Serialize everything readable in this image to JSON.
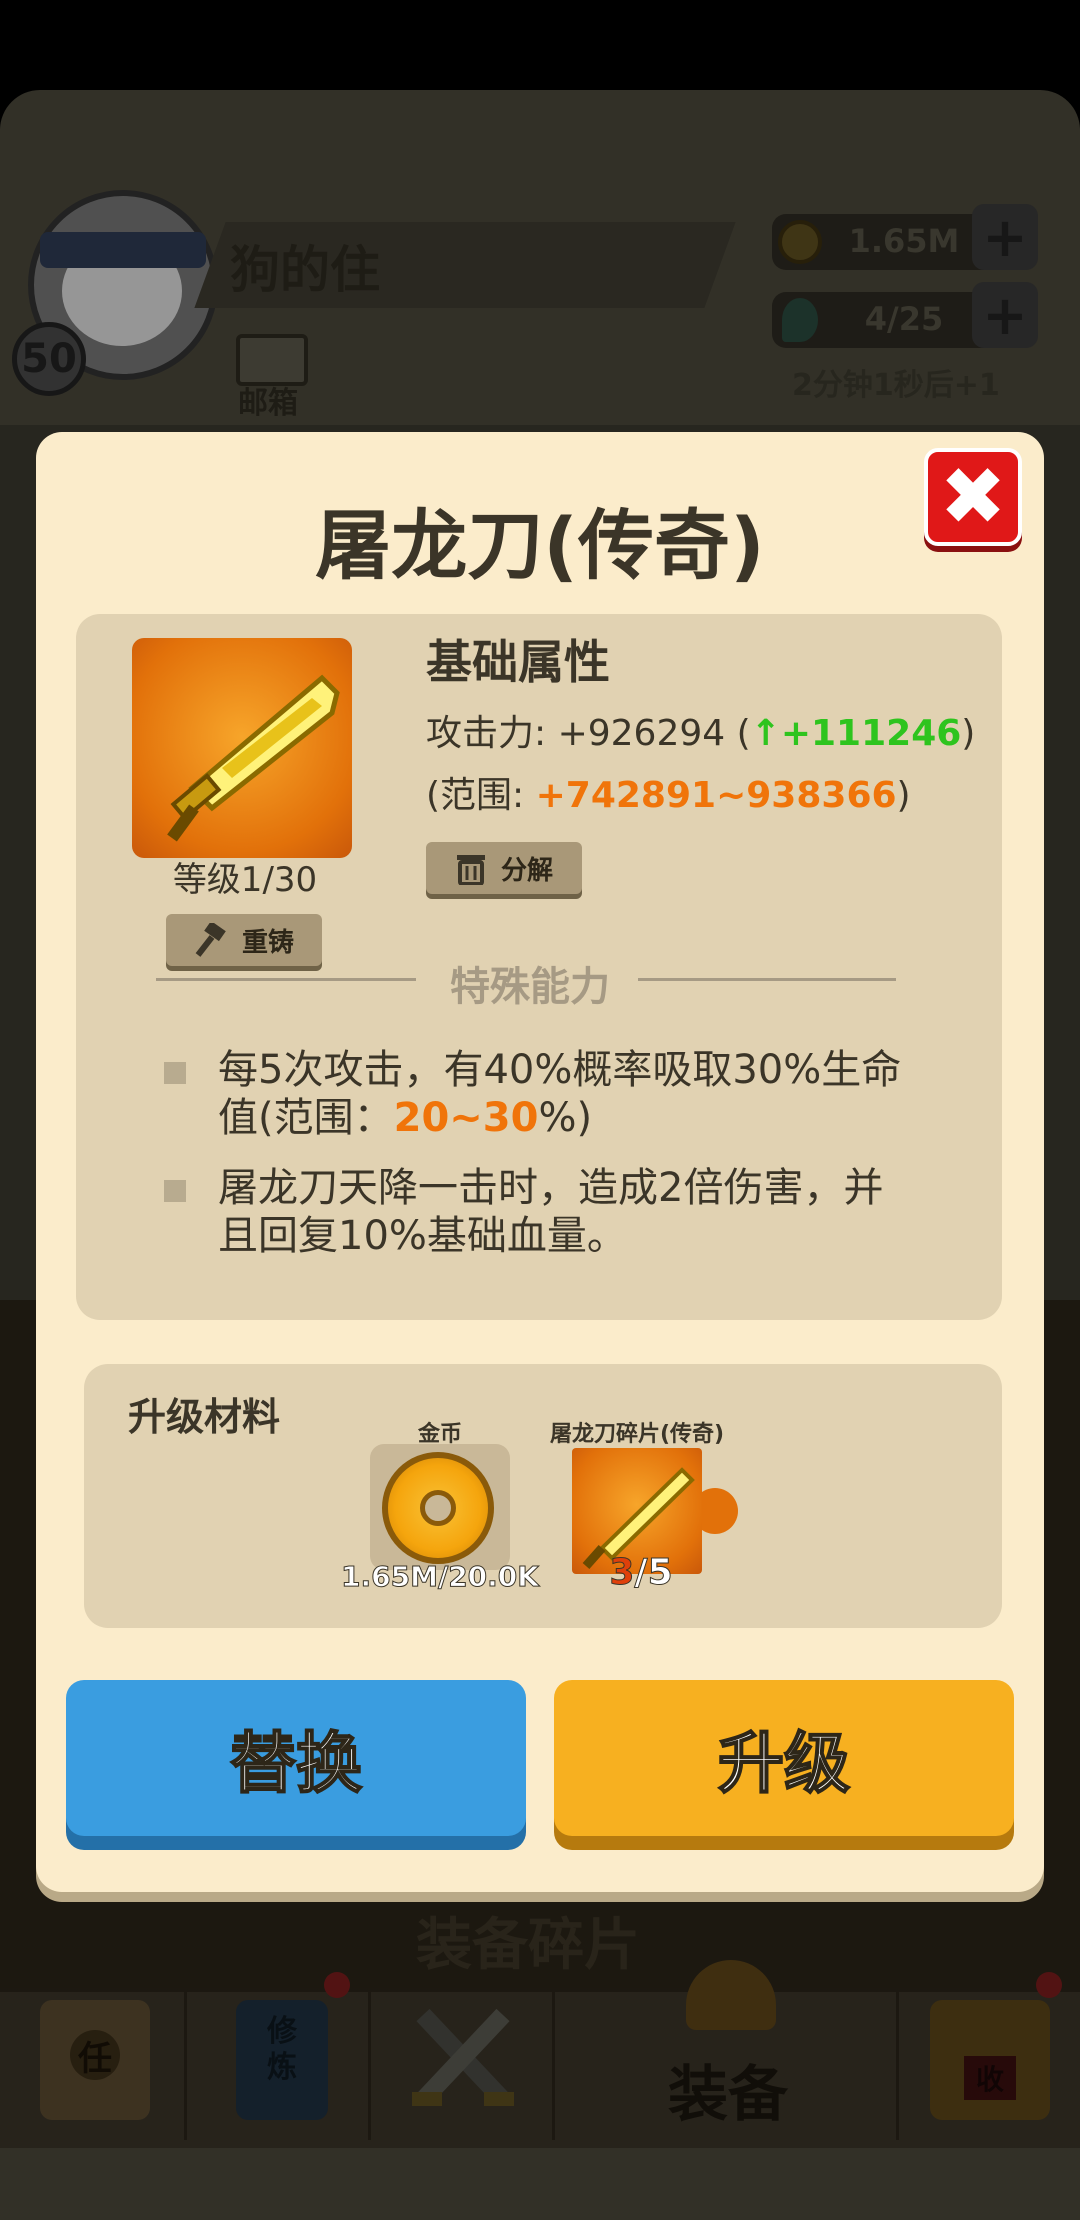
{
  "header": {
    "player_name": "狗的住",
    "level": "50",
    "mail_label": "邮箱",
    "gold_value": "1.65M",
    "energy_value": "4/25",
    "timer_text": "2分钟1秒后+1",
    "plus_symbol": "+"
  },
  "background": {
    "hidden_section_title": "装备碎片"
  },
  "bottom_nav": {
    "items": [
      {
        "icon": "scroll-icon",
        "text": "任"
      },
      {
        "icon": "book-icon",
        "text": "修炼"
      },
      {
        "icon": "crossed-swords-icon",
        "text": ""
      },
      {
        "icon": "helmet-icon",
        "label": "装备"
      },
      {
        "icon": "shop-icon",
        "text": "收"
      }
    ]
  },
  "dialog": {
    "title": "屠龙刀(传奇)",
    "close_symbol": "✖",
    "item": {
      "icon": "golden-sword-icon",
      "level_text": "等级1/30",
      "recast_label": "重铸",
      "decompose_label": "分解"
    },
    "base_attr": {
      "title": "基础属性",
      "attack_prefix": "攻击力: +926294 (",
      "attack_arrow": "↑",
      "attack_increase": "+111246",
      "attack_suffix": ")",
      "range_prefix": "(范围: ",
      "range_value": "+742891~938366",
      "range_suffix": ")"
    },
    "special": {
      "title": "特殊能力",
      "abilities": [
        {
          "pre": "每5次攻击，有40%概率吸取30%生命值(范围：",
          "highlight": "20~30",
          "post": "%)"
        },
        {
          "pre": "屠龙刀天降一击时，造成2倍伤害，并且回复10%基础血量。",
          "highlight": "",
          "post": ""
        }
      ]
    },
    "materials": {
      "title": "升级材料",
      "items": [
        {
          "name": "金币",
          "count": "1.65M/20.0K",
          "icon": "gold-coin-icon"
        },
        {
          "name": "屠龙刀碎片(传奇)",
          "count_have": "3",
          "count_need": "/5",
          "icon": "sword-fragment-icon"
        }
      ]
    },
    "buttons": {
      "replace_label": "替换",
      "upgrade_label": "升级"
    }
  },
  "colors": {
    "dialog_bg": "#fbeccb",
    "panel_bg": "#e1d2b2",
    "accent_green": "#2ec41e",
    "accent_orange": "#f0740a",
    "button_blue": "#3a9de0",
    "button_orange": "#f7b020",
    "close_red": "#e01818"
  }
}
